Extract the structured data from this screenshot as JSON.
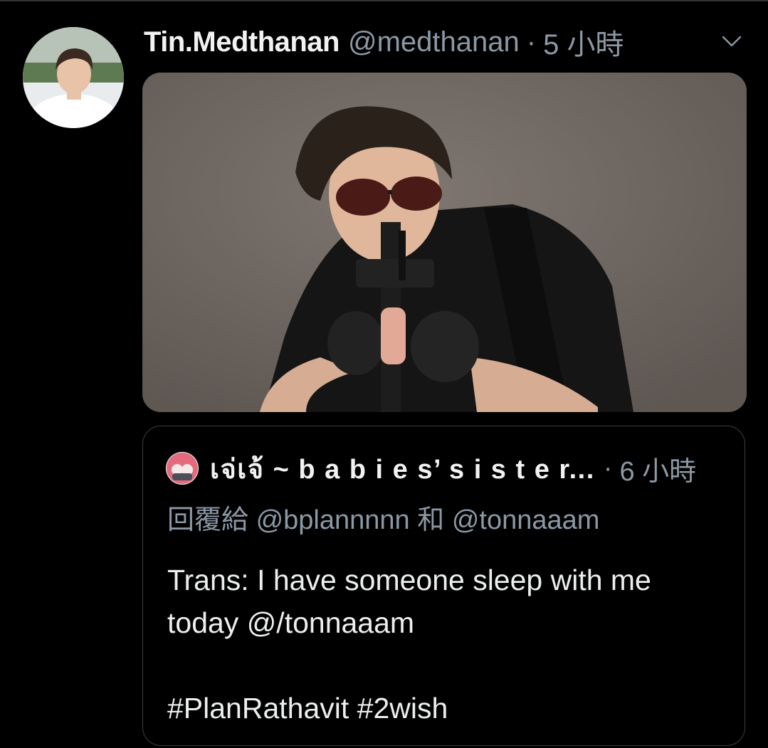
{
  "tweet": {
    "display_name": "Tin.Medthanan",
    "handle": "@medthanan",
    "separator": "·",
    "timestamp": "5 小時",
    "avatar_icon": "profile-photo",
    "menu_icon": "chevron-down-icon",
    "media_description_icon": "photo"
  },
  "quoted_tweet": {
    "display_name": "เจ่เจ้ ~ b a b i e s’ s i s t e r...",
    "separator": "·",
    "timestamp": "6 小時",
    "reply_prefix": "回覆給",
    "reply_user_1": "@bplannnnn",
    "reply_joiner": "和",
    "reply_user_2": "@tonnaaam",
    "text": "Trans: I have someone sleep with me today @/tonnaaam",
    "hashtags": "#PlanRathavit #2wish"
  },
  "colors": {
    "background": "#000000",
    "text_primary": "#e7e9ea",
    "text_secondary": "#8b98a5",
    "border": "#3a3f44"
  }
}
